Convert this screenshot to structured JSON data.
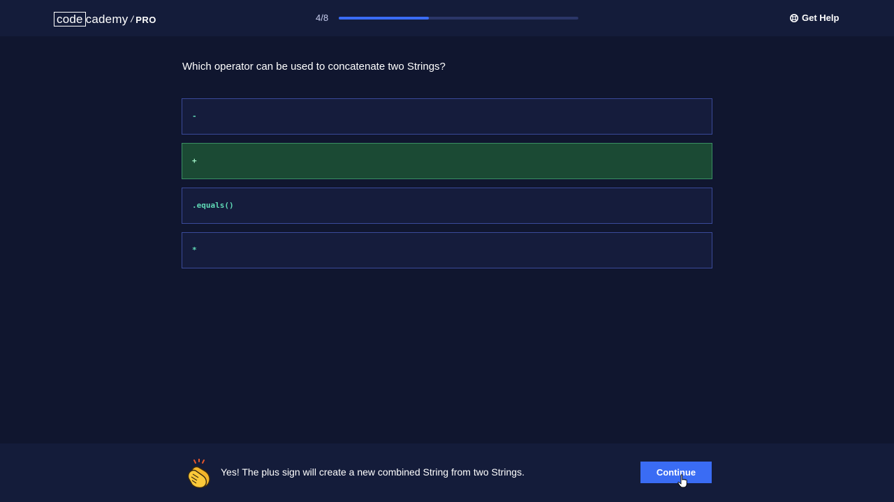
{
  "header": {
    "logo": {
      "boxed": "code",
      "rest": "cademy",
      "separator": "/",
      "tier": "PRO"
    },
    "progress": {
      "label": "4/8",
      "fraction": 0.375
    },
    "help_label": "Get Help"
  },
  "quiz": {
    "question": "Which operator can be used to concatenate two Strings?",
    "options": [
      {
        "text": "-",
        "state": "default"
      },
      {
        "text": "+",
        "state": "correct"
      },
      {
        "text": ".equals()",
        "state": "default"
      },
      {
        "text": "*",
        "state": "default"
      }
    ]
  },
  "footer": {
    "feedback": "Yes! The plus sign will create a new combined String from two Strings.",
    "continue_label": "Continue"
  },
  "colors": {
    "background": "#10162f",
    "bar": "#141c3a",
    "accent": "#3a6cf4",
    "correct": "#1b4a34",
    "code": "#5fd9b6"
  }
}
